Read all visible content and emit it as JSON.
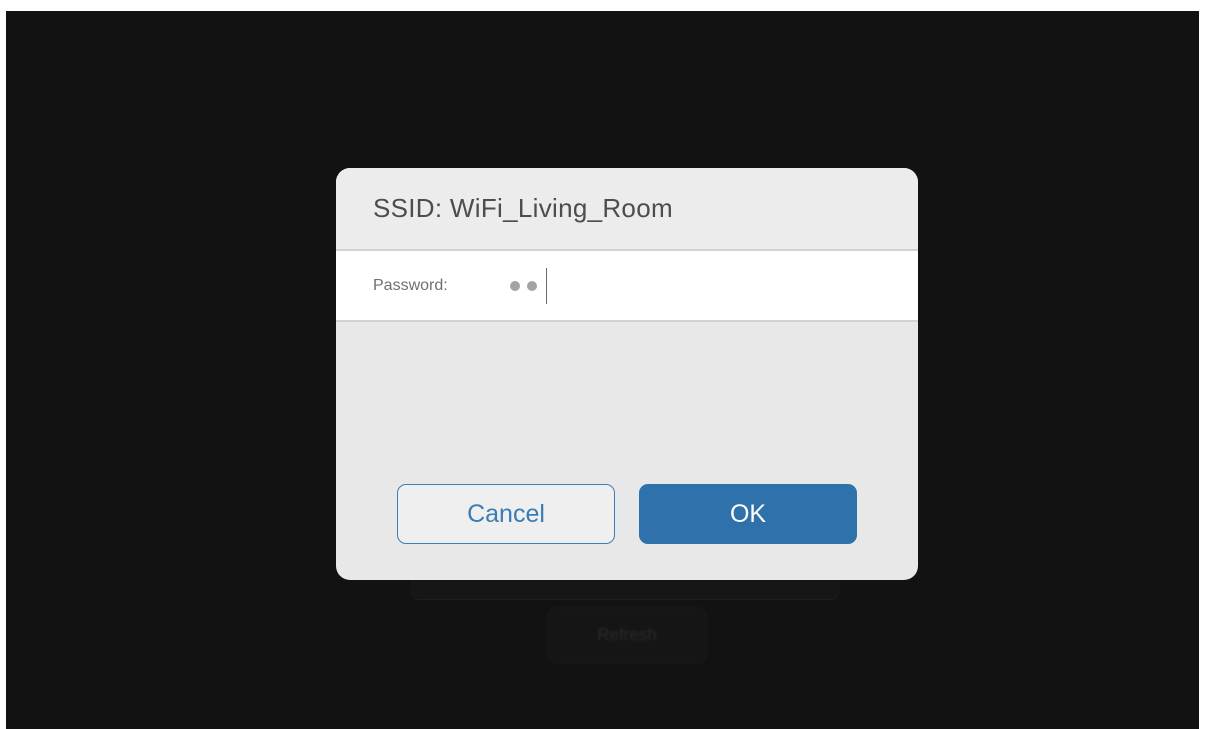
{
  "background": {
    "refresh_label": "Refresh"
  },
  "dialog": {
    "title": "SSID: WiFi_Living_Room",
    "password_label": "Password:",
    "password_dot_count": 2,
    "cancel_label": "Cancel",
    "ok_label": "OK"
  },
  "colors": {
    "accent": "#2f72ab",
    "screen_background": "#121212",
    "dialog_background": "#e8e8e8"
  },
  "icons": {
    "password_mask": "bullet-dot"
  }
}
